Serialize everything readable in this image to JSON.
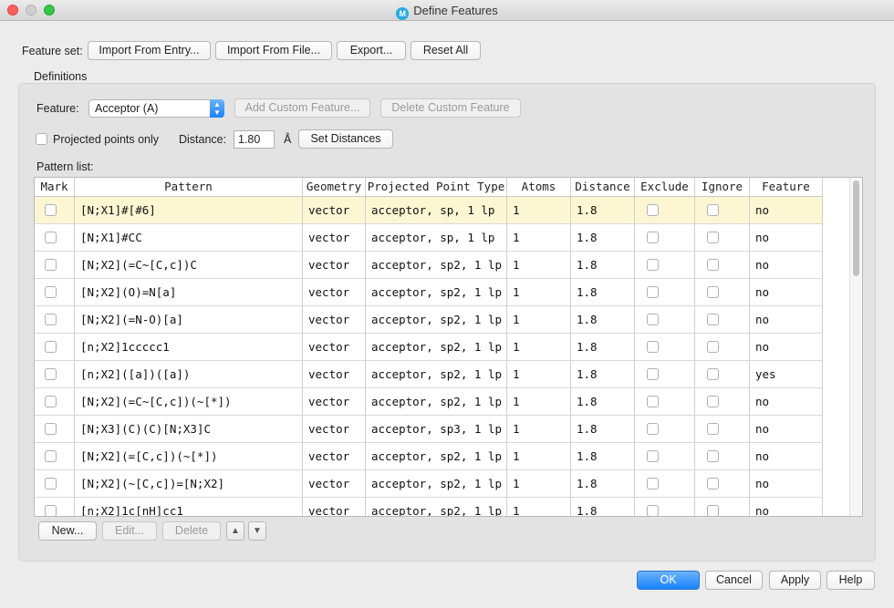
{
  "window": {
    "title": "Define Features",
    "app_icon_letter": "M"
  },
  "feature_set": {
    "label": "Feature set:",
    "import_entry": "Import From Entry...",
    "import_file": "Import From File...",
    "export": "Export...",
    "reset_all": "Reset All"
  },
  "definitions": {
    "group_label": "Definitions",
    "feature_label": "Feature:",
    "feature_value": "Acceptor (A)",
    "add_custom": "Add Custom Feature...",
    "delete_custom": "Delete Custom Feature",
    "projected_only_label": "Projected points only",
    "distance_label": "Distance:",
    "distance_value": "1.80",
    "distance_unit": "Å",
    "set_distances": "Set Distances",
    "pattern_list_label": "Pattern list:"
  },
  "table": {
    "columns": [
      "Mark",
      "Pattern",
      "Geometry",
      "Projected Point Type",
      "Atoms",
      "Distance",
      "Exclude",
      "Ignore",
      "Feature"
    ],
    "rows": [
      {
        "pattern": "[N;X1]#[#6]",
        "geometry": "vector",
        "ppt": "acceptor, sp, 1 lp",
        "atoms": "1",
        "distance": "1.8",
        "feature": "no",
        "selected": true
      },
      {
        "pattern": "[N;X1]#CC",
        "geometry": "vector",
        "ppt": "acceptor, sp, 1 lp",
        "atoms": "1",
        "distance": "1.8",
        "feature": "no"
      },
      {
        "pattern": "[N;X2](=C~[C,c])C",
        "geometry": "vector",
        "ppt": "acceptor, sp2, 1 lp",
        "atoms": "1",
        "distance": "1.8",
        "feature": "no"
      },
      {
        "pattern": "[N;X2](O)=N[a]",
        "geometry": "vector",
        "ppt": "acceptor, sp2, 1 lp",
        "atoms": "1",
        "distance": "1.8",
        "feature": "no"
      },
      {
        "pattern": "[N;X2](=N-O)[a]",
        "geometry": "vector",
        "ppt": "acceptor, sp2, 1 lp",
        "atoms": "1",
        "distance": "1.8",
        "feature": "no"
      },
      {
        "pattern": "[n;X2]1ccccc1",
        "geometry": "vector",
        "ppt": "acceptor, sp2, 1 lp",
        "atoms": "1",
        "distance": "1.8",
        "feature": "no"
      },
      {
        "pattern": "[n;X2]([a])([a])",
        "geometry": "vector",
        "ppt": "acceptor, sp2, 1 lp",
        "atoms": "1",
        "distance": "1.8",
        "feature": "yes"
      },
      {
        "pattern": "[N;X2](=C~[C,c])(~[*])",
        "geometry": "vector",
        "ppt": "acceptor, sp2, 1 lp",
        "atoms": "1",
        "distance": "1.8",
        "feature": "no"
      },
      {
        "pattern": "[N;X3](C)(C)[N;X3]C",
        "geometry": "vector",
        "ppt": "acceptor, sp3, 1 lp",
        "atoms": "1",
        "distance": "1.8",
        "feature": "no"
      },
      {
        "pattern": "[N;X2](=[C,c])(~[*])",
        "geometry": "vector",
        "ppt": "acceptor, sp2, 1 lp",
        "atoms": "1",
        "distance": "1.8",
        "feature": "no"
      },
      {
        "pattern": "[N;X2](~[C,c])=[N;X2]",
        "geometry": "vector",
        "ppt": "acceptor, sp2, 1 lp",
        "atoms": "1",
        "distance": "1.8",
        "feature": "no"
      },
      {
        "pattern": "[n;X2]1c[nH]cc1",
        "geometry": "vector",
        "ppt": "acceptor, sp2, 1 lp",
        "atoms": "1",
        "distance": "1.8",
        "feature": "no"
      }
    ]
  },
  "list_buttons": {
    "new": "New...",
    "edit": "Edit...",
    "delete": "Delete",
    "up": "▲",
    "down": "▼"
  },
  "dialog_buttons": {
    "ok": "OK",
    "cancel": "Cancel",
    "apply": "Apply",
    "help": "Help"
  },
  "colors": {
    "selected_row": "#fdf6d3",
    "primary_button": "#1a82fb",
    "app_icon": "#29a9e0"
  }
}
